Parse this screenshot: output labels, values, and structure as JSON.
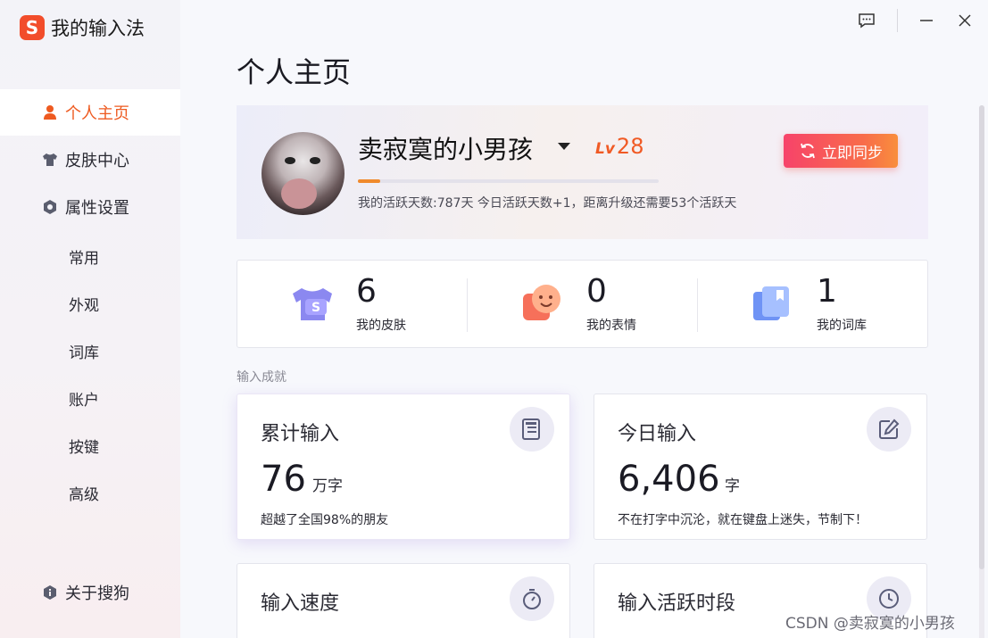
{
  "app": {
    "logo_glyph": "S",
    "title": "我的输入法",
    "brand_color": "#f24d2b"
  },
  "sidebar": {
    "items": [
      {
        "label": "个人主页",
        "icon": "person-icon",
        "active": true
      },
      {
        "label": "皮肤中心",
        "icon": "shirt-icon",
        "active": false
      },
      {
        "label": "属性设置",
        "icon": "hexagon-gear-icon",
        "active": false
      }
    ],
    "sub_items": [
      "常用",
      "外观",
      "词库",
      "账户",
      "按键",
      "高级"
    ],
    "about": {
      "label": "关于搜狗",
      "icon": "info-shield-icon"
    }
  },
  "main": {
    "title": "个人主页",
    "profile": {
      "username": "卖寂寞的小男孩",
      "level_prefix": "Lv",
      "level": "28",
      "progress_fraction": 0.075,
      "active_text": "我的活跃天数:787天 今日活跃天数+1，距离升级还需要53个活跃天",
      "sync_label": "立即同步",
      "accent_color": "#f05a24"
    },
    "stats": [
      {
        "value": "6",
        "label": "我的皮肤",
        "icon": "skin-shirt-icon"
      },
      {
        "value": "0",
        "label": "我的表情",
        "icon": "emoji-face-icon"
      },
      {
        "value": "1",
        "label": "我的词库",
        "icon": "dictionary-book-icon"
      }
    ],
    "section_label": "输入成就",
    "cards": [
      {
        "title": "累计输入",
        "value": "76",
        "unit": "万字",
        "desc": "超越了全国98%的朋友",
        "icon": "document-list-icon"
      },
      {
        "title": "今日输入",
        "value": "6,406",
        "unit": "字",
        "desc": "不在打字中沉沦，就在键盘上迷失，节制下！",
        "icon": "edit-pen-icon"
      },
      {
        "title": "输入速度",
        "icon": "stopwatch-icon"
      },
      {
        "title": "输入活跃时段",
        "icon": "clock-icon"
      }
    ]
  },
  "watermark": "CSDN @卖寂寞的小男孩"
}
